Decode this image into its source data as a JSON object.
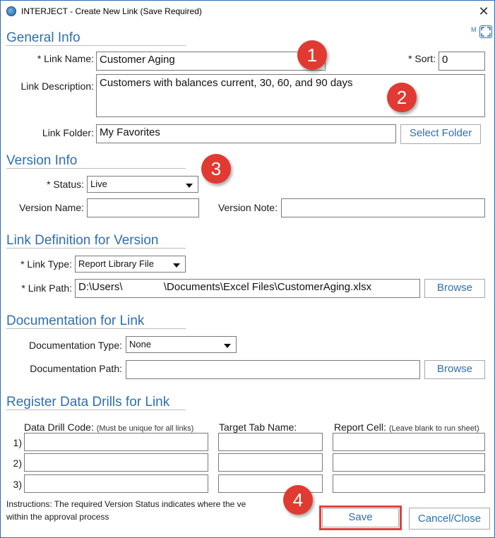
{
  "window": {
    "title": "INTERJECT - Create New Link (Save Required)",
    "close_glyph": "✕",
    "expand_hint": "M"
  },
  "general": {
    "section_title": "General Info",
    "link_name_label": "* Link Name:",
    "link_name_value": "Customer Aging",
    "sort_label": "* Sort:",
    "sort_value": "0",
    "description_label": "Link Description:",
    "description_value": "Customers with balances current, 30, 60, and 90 days",
    "folder_label": "Link Folder:",
    "folder_value": "My Favorites",
    "select_folder_button": "Select Folder"
  },
  "version": {
    "section_title": "Version Info",
    "status_label": "* Status:",
    "status_value": "Live",
    "version_name_label": "Version Name:",
    "version_name_value": "",
    "version_note_label": "Version Note:",
    "version_note_value": ""
  },
  "definition": {
    "section_title": "Link Definition for Version",
    "link_type_label": "* Link Type:",
    "link_type_value": "Report Library File",
    "link_path_label": "* Link Path:",
    "link_path_value": "D:\\Users\\              \\Documents\\Excel Files\\CustomerAging.xlsx",
    "browse_button": "Browse"
  },
  "documentation": {
    "section_title": "Documentation for Link",
    "doc_type_label": "Documentation Type:",
    "doc_type_value": "None",
    "doc_path_label": "Documentation Path:",
    "doc_path_value": "",
    "browse_button": "Browse"
  },
  "drills": {
    "section_title": "Register Data Drills for Link",
    "col_code": "Data Drill Code:",
    "col_code_hint": "(Must be unique for all links)",
    "col_tab": "Target Tab Name:",
    "col_cell": "Report Cell:",
    "col_cell_hint": "(Leave blank to run sheet)",
    "rows": [
      "1)",
      "2)",
      "3)"
    ]
  },
  "footer": {
    "instructions_line1": "Instructions: The required Version Status indicates where the ve",
    "instructions_line2": "within the approval process",
    "save_button": "Save",
    "cancel_button": "Cancel/Close"
  },
  "callouts": [
    "1",
    "2",
    "3",
    "4"
  ],
  "colors": {
    "accent": "#2f6fae",
    "callout": "#e03a32",
    "highlight": "#e04040"
  }
}
